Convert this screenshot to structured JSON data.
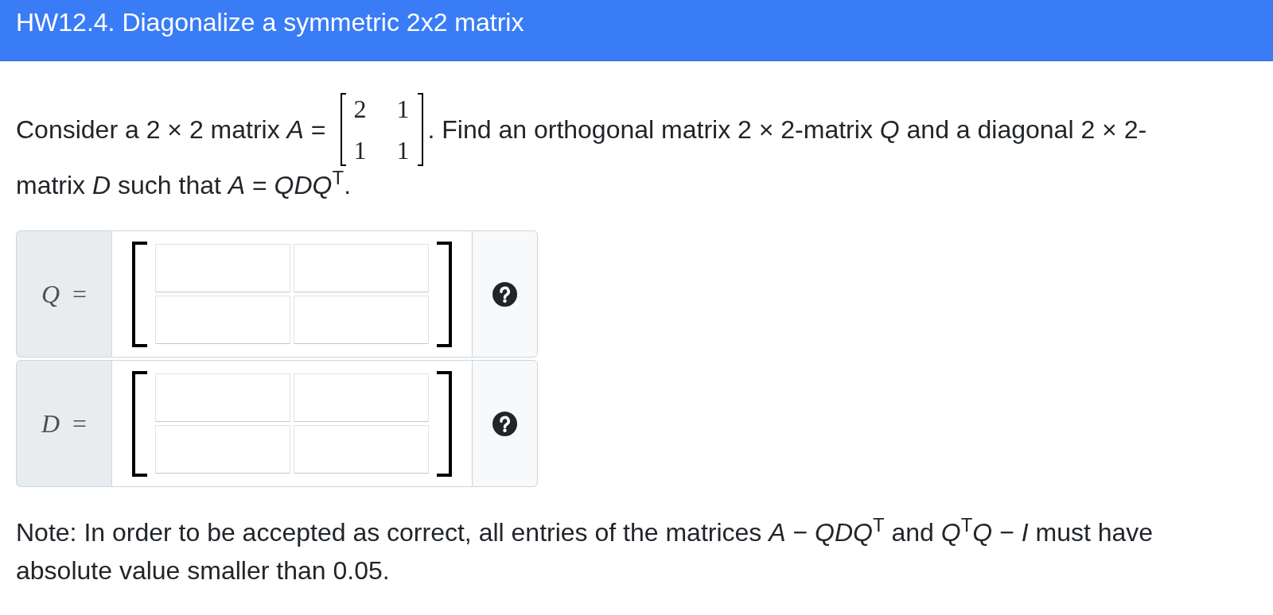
{
  "header": {
    "title": "HW12.4. Diagonalize a symmetric 2x2 matrix"
  },
  "question": {
    "text_before": "Consider a 2 × 2 matrix *A* =",
    "matrix": [
      [
        "2",
        "1"
      ],
      [
        "1",
        "1"
      ]
    ],
    "text_after": ". Find an orthogonal matrix 2 × 2-matrix *Q* and a diagonal 2 × 2-",
    "text_continued": "matrix *D* such that *A* = *QDQ*$^{T}$."
  },
  "answers": [
    {
      "label": "*Q* ="
    },
    {
      "label": "*D* ="
    }
  ],
  "note": "Note: In order to be accepted as correct, all entries of the matrices *A* − *QDQ*$^{T}$ and *Q*$^{T}$*Q* − *I* must have absolute value smaller than 0.05."
}
